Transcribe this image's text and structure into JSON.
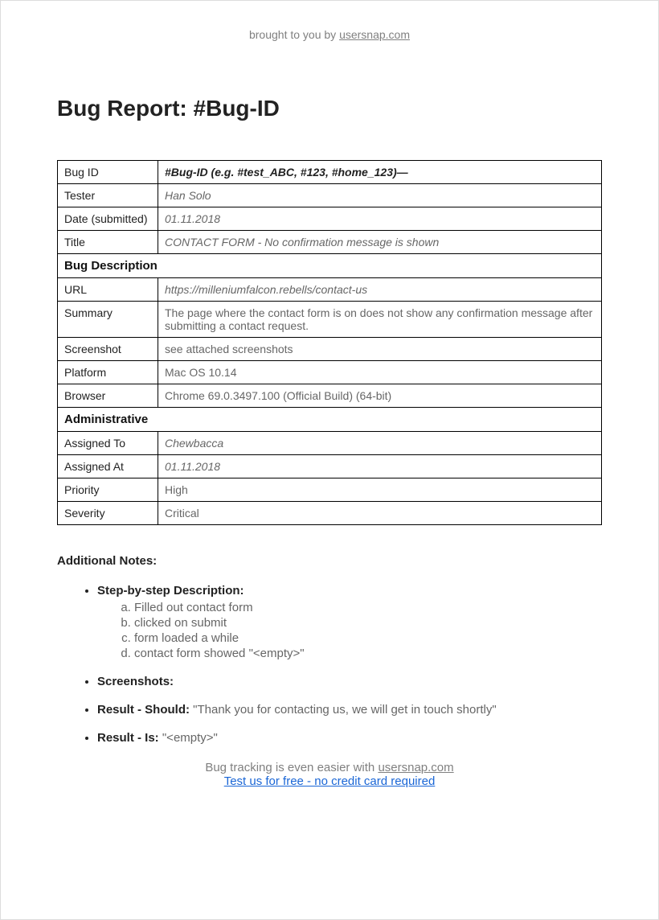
{
  "header": {
    "prefix": "brought to you by ",
    "link_text": "usersnap.com"
  },
  "title": "Bug Report: #Bug-ID",
  "sections": {
    "top_rows": [
      {
        "label": "Bug ID",
        "value": "#Bug-ID (e.g. #test_ABC, #123, #home_123)—",
        "style": "bold-italic"
      },
      {
        "label": "Tester",
        "value": "Han Solo",
        "style": "italic"
      },
      {
        "label": "Date (submitted)",
        "value": "01.11.2018",
        "style": "italic"
      },
      {
        "label": "Title",
        "value": "CONTACT FORM - No confirmation message is shown",
        "style": "italic"
      }
    ],
    "bug_desc_header": "Bug Description",
    "bug_desc_rows": [
      {
        "label": "URL",
        "value": "https://milleniumfalcon.rebells/contact-us",
        "style": "italic"
      },
      {
        "label": "Summary",
        "value": "The page where the contact form is on does not show any confirmation message after submitting a contact request.",
        "style": "plain"
      },
      {
        "label": "Screenshot",
        "value": "see attached screenshots",
        "style": "plain"
      },
      {
        "label": "Platform",
        "value": "Mac OS 10.14",
        "style": "plain"
      },
      {
        "label": "Browser",
        "value": "Chrome 69.0.3497.100 (Official Build) (64-bit)",
        "style": "plain"
      }
    ],
    "admin_header": "Administrative",
    "admin_rows": [
      {
        "label": "Assigned To",
        "value": "Chewbacca",
        "style": "italic"
      },
      {
        "label": "Assigned At",
        "value": "01.11.2018",
        "style": "italic"
      },
      {
        "label": "Priority",
        "value": "High",
        "style": "plain"
      },
      {
        "label": "Severity",
        "value": "Critical",
        "style": "plain"
      }
    ]
  },
  "notes": {
    "title": "Additional Notes:",
    "step_label": "Step-by-step Description:",
    "steps": [
      "Filled out contact form",
      "clicked on submit",
      "form loaded a while",
      "contact form showed \"<empty>\""
    ],
    "screenshots_label": "Screenshots:",
    "result_should_label": "Result - Should: ",
    "result_should_value": "\"Thank you for contacting us, we will get in touch shortly\"",
    "result_is_label": "Result - Is: ",
    "result_is_value": "\"<empty>\""
  },
  "footer": {
    "line1_prefix": "Bug tracking is even easier with ",
    "line1_link": "usersnap.com",
    "line2_link": "Test us for free - no credit card required"
  }
}
